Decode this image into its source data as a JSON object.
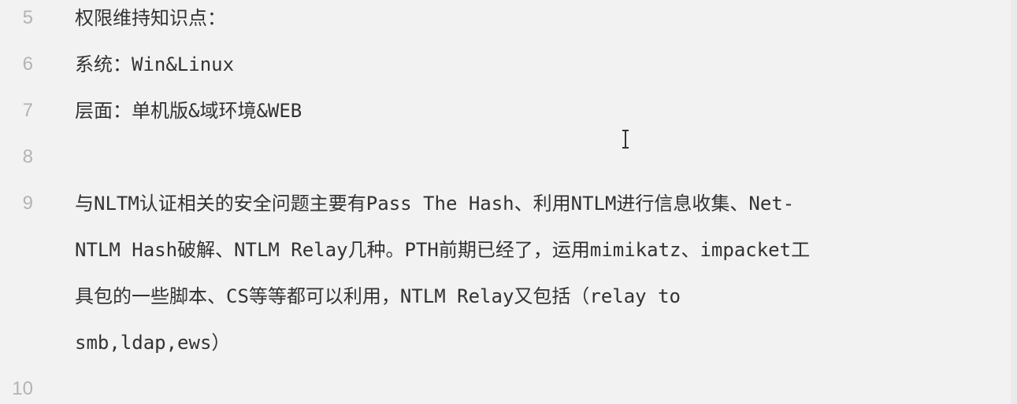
{
  "editor": {
    "lines": [
      {
        "number": "5",
        "text": "权限维持知识点："
      },
      {
        "number": "6",
        "text": "系统：Win&Linux"
      },
      {
        "number": "7",
        "text": "层面：单机版&域环境&WEB"
      },
      {
        "number": "8",
        "text": ""
      },
      {
        "number": "9",
        "wrapped": [
          "与NLTM认证相关的安全问题主要有Pass The Hash、利用NTLM进行信息收集、Net-",
          "NTLM Hash破解、NTLM Relay几种。PTH前期已经了，运用mimikatz、impacket工",
          "具包的一些脚本、CS等等都可以利用，NTLM Relay又包括（relay to",
          "smb,ldap,ews）"
        ]
      },
      {
        "number": "10",
        "text": ""
      }
    ]
  },
  "colors": {
    "background": "#f2f2f2",
    "text": "#333333",
    "line_number": "#b3b3b3"
  },
  "icons": {
    "text_cursor": "i-beam-cursor-icon"
  }
}
